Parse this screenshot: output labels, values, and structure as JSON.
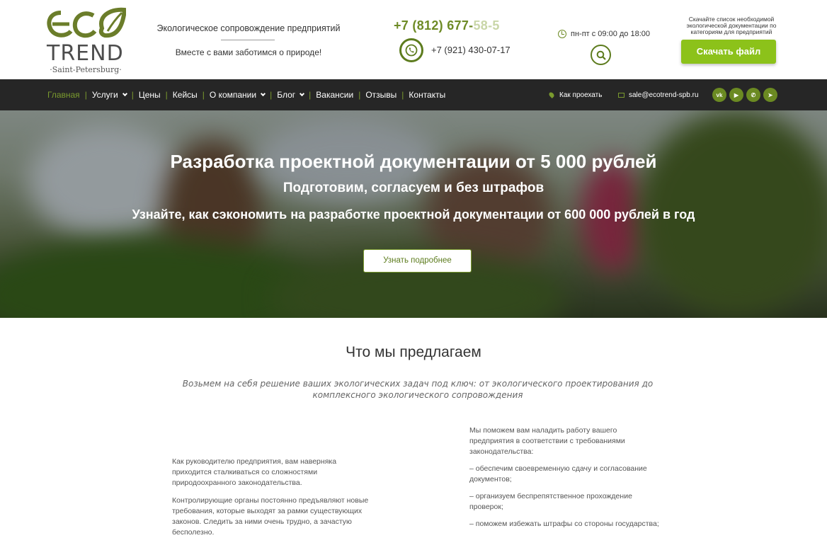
{
  "header": {
    "logo": {
      "eco": "ECO",
      "trend": "TREND",
      "city": "·Saint-Petersburg·"
    },
    "tagline_top": "Экологическое сопровождение предприятий",
    "tagline_bottom": "Вместе с вами заботимся о природе!",
    "phone_main_visible": "+7 (812) 677-",
    "phone_main_faded": "58-5",
    "phone_second": "+7 (921) 430-07-17",
    "hours": "пн-пт с 09:00 до 18:00",
    "download_note": "Скачайте список необходимой экологической документации по категориям для предприятий",
    "download_button": "Скачать файл",
    "icons": [
      "whatsapp-icon",
      "clock-icon",
      "search-icon"
    ]
  },
  "nav": {
    "items": [
      {
        "label": "Главная",
        "active": true,
        "dropdown": false
      },
      {
        "label": "Услуги",
        "active": false,
        "dropdown": true
      },
      {
        "label": "Цены",
        "active": false,
        "dropdown": false
      },
      {
        "label": "Кейсы",
        "active": false,
        "dropdown": false
      },
      {
        "label": "О компании",
        "active": false,
        "dropdown": true
      },
      {
        "label": "Блог",
        "active": false,
        "dropdown": true
      },
      {
        "label": "Вакансии",
        "active": false,
        "dropdown": false
      },
      {
        "label": "Отзывы",
        "active": false,
        "dropdown": false
      },
      {
        "label": "Контакты",
        "active": false,
        "dropdown": false
      }
    ],
    "route": "Как проехать",
    "email": "sale@ecotrend-spb.ru",
    "socials": [
      {
        "name": "vk-icon",
        "glyph": "vk"
      },
      {
        "name": "youtube-icon",
        "glyph": "▶"
      },
      {
        "name": "whatsapp-icon",
        "glyph": "✆"
      },
      {
        "name": "telegram-icon",
        "glyph": "➤"
      }
    ]
  },
  "hero": {
    "title": "Разработка проектной документации от 5 000 рублей",
    "subtitle": "Подготовим, согласуем и без штрафов",
    "subtitle2": "Узнайте, как сэкономить на разработке проектной документации от 600 000 рублей в год",
    "button": "Узнать подробнее"
  },
  "offer": {
    "title": "Что мы предлагаем",
    "lead": "Возьмем на себя решение ваших экологических задач под ключ: от экологического проектирования до комплексного экологического сопровождения",
    "left": [
      "Как руководителю предприятия,  вам наверняка приходится сталкиваться со сложностями природоохранного законодательства.",
      "Контролирующие органы постоянно предъявляют новые требования, которые выходят за рамки существующих законов. Следить за ними очень трудно, а зачастую бесполезно."
    ],
    "right": [
      "Мы поможем вам наладить работу вашего предприятия в соответствии  с требованиями законодательства:",
      "– обеспечим своевременную сдачу и согласование документов;",
      "– организуем беспрепятственное прохождение проверок;",
      "– поможем избежать штрафы со стороны государства;"
    ]
  },
  "colors": {
    "brand_green": "#8cc21a",
    "dark_green": "#5d7c1e",
    "nav_bg": "#262626"
  }
}
